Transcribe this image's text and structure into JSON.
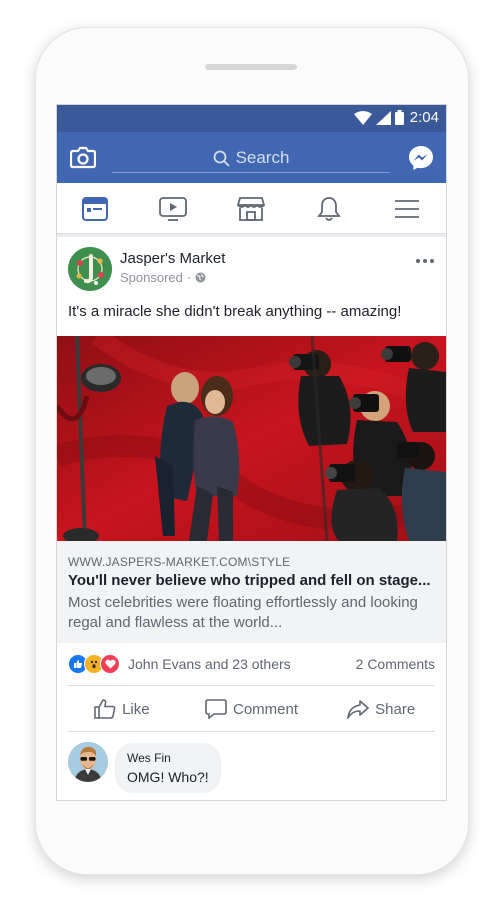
{
  "status_bar": {
    "time": "2:04"
  },
  "header": {
    "search_placeholder": "Search"
  },
  "nav": {
    "items": [
      {
        "name": "news-feed",
        "active": true
      },
      {
        "name": "watch"
      },
      {
        "name": "marketplace"
      },
      {
        "name": "notifications"
      },
      {
        "name": "menu"
      }
    ]
  },
  "post": {
    "page_name": "Jasper's Market",
    "sponsored_label": "Sponsored",
    "sponsored_separator": "·",
    "message": "It's a miracle she didn't break anything -- amazing!",
    "link": {
      "url": "WWW.JASPERS-MARKET.COM\\STYLE",
      "title": "You'll never believe who tripped and fell on stage...",
      "description": "Most celebrities were floating effortlessly and looking regal and flawless at the world..."
    },
    "reactions": {
      "names": "John Evans and 23 others",
      "comments": "2 Comments",
      "types": [
        "like",
        "wow",
        "love"
      ]
    },
    "actions": {
      "like": "Like",
      "comment": "Comment",
      "share": "Share"
    },
    "top_comment": {
      "author": "Wes Fin",
      "text": "OMG! Who?!"
    }
  },
  "colors": {
    "brand": "#4267b2",
    "status_bar": "#3b5998",
    "active_nav": "#4267b2",
    "red_carpet": "#b5121b"
  }
}
